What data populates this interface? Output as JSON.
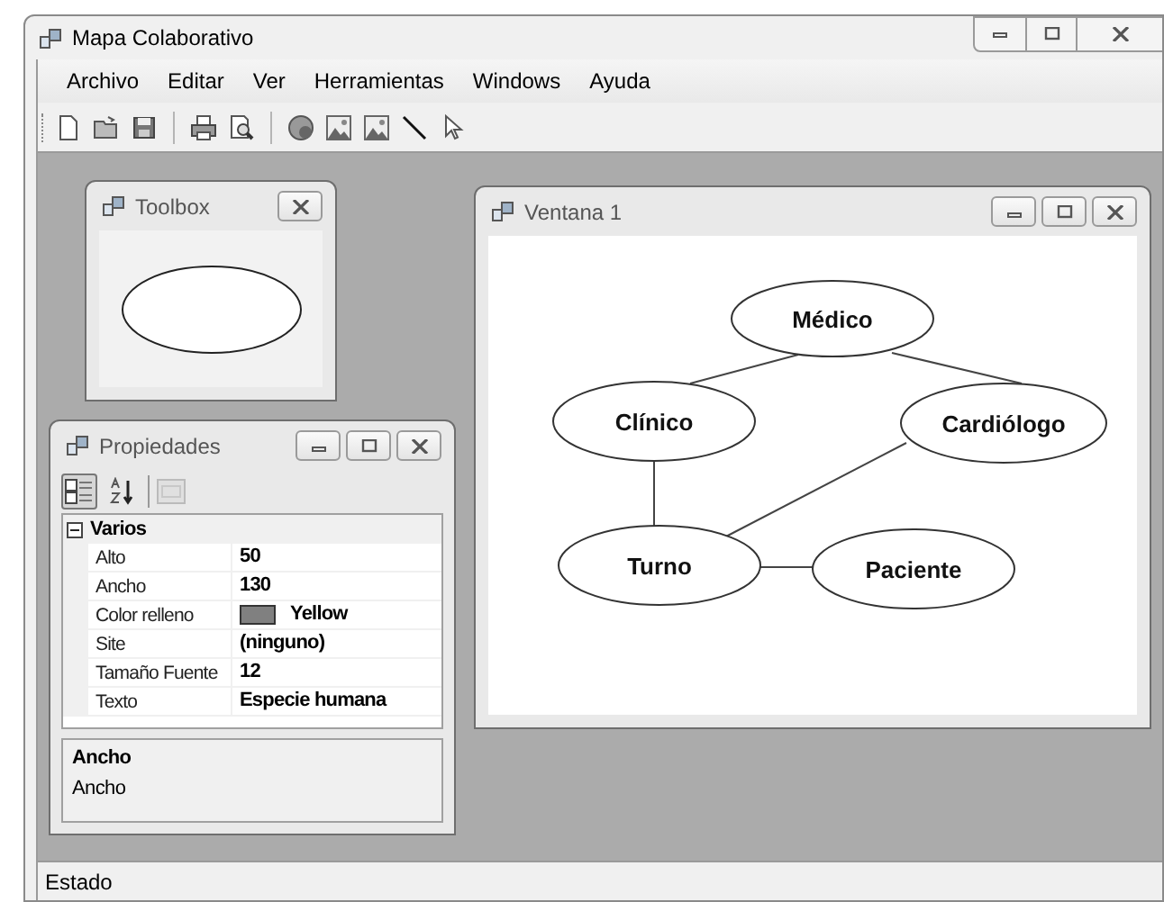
{
  "window": {
    "title": "Mapa Colaborativo"
  },
  "menu": [
    "Archivo",
    "Editar",
    "Ver",
    "Herramientas",
    "Windows",
    "Ayuda"
  ],
  "toolbox": {
    "title": "Toolbox"
  },
  "properties": {
    "title": "Propiedades",
    "view_buttons": [
      {
        "kind": "categorized",
        "selected": true
      },
      {
        "kind": "alphabetical",
        "selected": false
      }
    ],
    "category": {
      "label": "Varios",
      "expanded": true
    },
    "rows": [
      {
        "kind": "text",
        "name": "Alto",
        "value": "50"
      },
      {
        "kind": "text",
        "name": "Ancho",
        "value": "130"
      },
      {
        "kind": "color",
        "name": "Color relleno",
        "value": "Yellow",
        "color": "#808080"
      },
      {
        "kind": "text",
        "name": "Site",
        "value": "(ninguno)"
      },
      {
        "kind": "text",
        "name": "Tamaño Fuente",
        "value": "12"
      },
      {
        "kind": "text",
        "name": "Texto",
        "value": "Especie humana"
      }
    ],
    "description": {
      "title": "Ancho",
      "text": "Ancho"
    }
  },
  "document": {
    "title": "Ventana 1",
    "nodes": [
      {
        "label": "Médico"
      },
      {
        "label": "Clínico"
      },
      {
        "label": "Cardiólogo"
      },
      {
        "label": "Turno"
      },
      {
        "label": "Paciente"
      }
    ]
  },
  "status_bar": {
    "text": "Estado"
  }
}
